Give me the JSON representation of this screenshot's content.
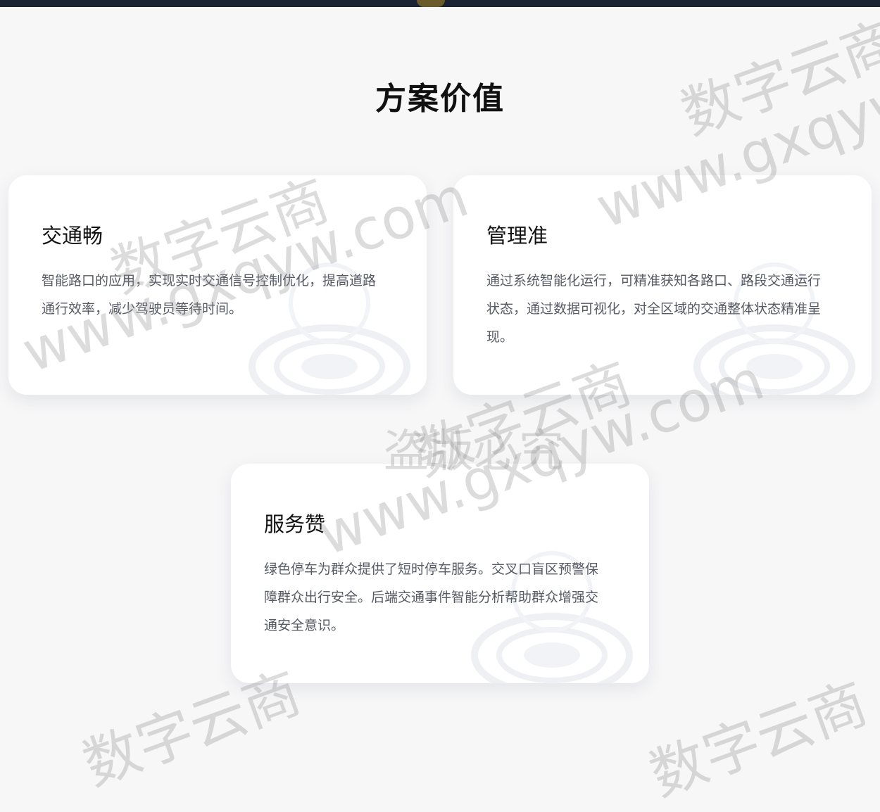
{
  "section": {
    "title": "方案价值"
  },
  "cards": [
    {
      "title": "交通畅",
      "description": "智能路口的应用，实现实时交通信号控制优化，提高道路通行效率，减少驾驶员等待时间。"
    },
    {
      "title": "管理准",
      "description": "通过系统智能化运行，可精准获知各路口、路段交通运行状态，通过数据可视化，对全区域的交通整体状态精准呈现。"
    },
    {
      "title": "服务赞",
      "description": "绿色停车为群众提供了短时停车服务。交叉口盲区预警保障群众出行安全。后端交通事件智能分析帮助群众增强交通安全意识。"
    }
  ],
  "watermark": {
    "brand": "数字云商",
    "url": "www.gxqyw.com",
    "notice": "盗版必究"
  }
}
